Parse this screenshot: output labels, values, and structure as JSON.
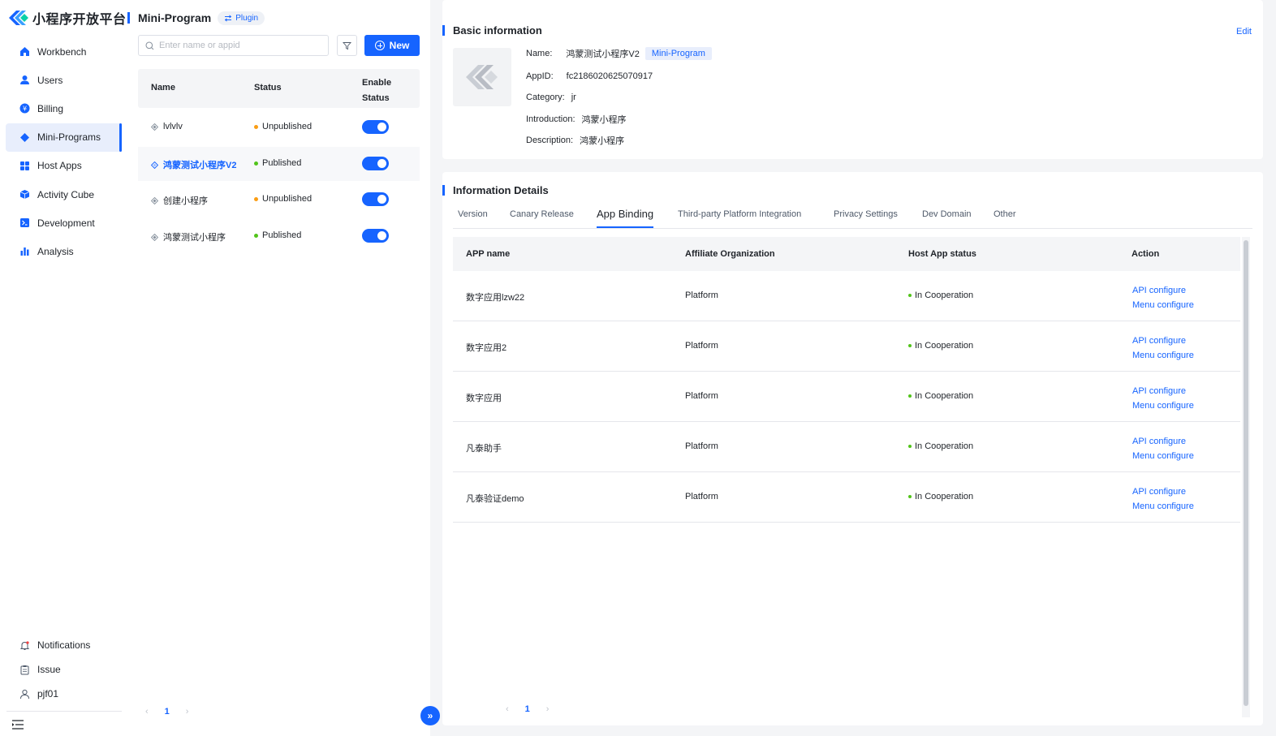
{
  "brand": {
    "name": "小程序开放平台"
  },
  "sidebar": {
    "items": [
      {
        "label": "Workbench",
        "icon": "home-icon"
      },
      {
        "label": "Users",
        "icon": "user-icon"
      },
      {
        "label": "Billing",
        "icon": "billing-icon"
      },
      {
        "label": "Mini-Programs",
        "icon": "diamond-icon",
        "active": true
      },
      {
        "label": "Host Apps",
        "icon": "grid-icon"
      },
      {
        "label": "Activity Cube",
        "icon": "cube-icon"
      },
      {
        "label": "Development",
        "icon": "terminal-icon"
      },
      {
        "label": "Analysis",
        "icon": "bar-chart-icon"
      }
    ],
    "bottom": [
      {
        "label": "Notifications",
        "icon": "bell-icon"
      },
      {
        "label": "Issue",
        "icon": "clipboard-icon"
      },
      {
        "label": "pjf01",
        "icon": "person-icon"
      }
    ]
  },
  "list_panel": {
    "title": "Mini-Program",
    "plugin_label": "Plugin",
    "search_placeholder": "Enter name or appid",
    "new_label": "New",
    "columns": {
      "name": "Name",
      "status": "Status",
      "enable_status_1": "Enable",
      "enable_status_2": "Status"
    },
    "rows": [
      {
        "name": "lvlvlv",
        "status": "Unpublished",
        "status_color": "#fa9d14",
        "enabled": true
      },
      {
        "name": "鸿蒙测试小程序V2",
        "status": "Published",
        "status_color": "#52c41a",
        "enabled": true,
        "selected": true
      },
      {
        "name": "创建小程序",
        "status": "Unpublished",
        "status_color": "#fa9d14",
        "enabled": true
      },
      {
        "name": "鸿蒙测试小程序",
        "status": "Published",
        "status_color": "#52c41a",
        "enabled": true
      }
    ],
    "pager": {
      "page": "1",
      "prev": "‹",
      "next": "›"
    }
  },
  "basic_info": {
    "title": "Basic information",
    "edit_label": "Edit",
    "name_label": "Name:",
    "name_value": "鸿蒙测试小程序V2",
    "type_tag": "Mini-Program",
    "appid_label": "AppID:",
    "appid_value": "fc2186020625070917",
    "category_label": "Category:",
    "category_value": "jr",
    "intro_label": "Introduction:",
    "intro_value": "鸿蒙小程序",
    "desc_label": "Description:",
    "desc_value": "鸿蒙小程序"
  },
  "details": {
    "title": "Information Details",
    "tabs": [
      "Version",
      "Canary Release",
      "App Binding",
      "Third-party Platform Integration",
      "Privacy Settings",
      "Dev Domain",
      "Other"
    ],
    "active_tab": "App Binding",
    "table": {
      "headers": [
        "APP name",
        "Affiliate Organization",
        "Host App status",
        "Action"
      ],
      "rows": [
        {
          "app": "数字应用lzw22",
          "org": "Platform",
          "status": "In Cooperation",
          "action1": "API configure",
          "action2": "Menu configure"
        },
        {
          "app": "数字应用2",
          "org": "Platform",
          "status": "In Cooperation",
          "action1": "API configure",
          "action2": "Menu configure"
        },
        {
          "app": "数字应用",
          "org": "Platform",
          "status": "In Cooperation",
          "action1": "API configure",
          "action2": "Menu configure"
        },
        {
          "app": "凡泰助手",
          "org": "Platform",
          "status": "In Cooperation",
          "action1": "API configure",
          "action2": "Menu configure"
        },
        {
          "app": "凡泰验证demo",
          "org": "Platform",
          "status": "In Cooperation",
          "action1": "API configure",
          "action2": "Menu configure"
        }
      ]
    },
    "pager": {
      "page": "1",
      "prev": "‹",
      "next": "›"
    }
  },
  "expand_glyph": "»",
  "colors": {
    "accent": "#1664ff",
    "published": "#52c41a",
    "unpublished": "#fa9d14"
  }
}
